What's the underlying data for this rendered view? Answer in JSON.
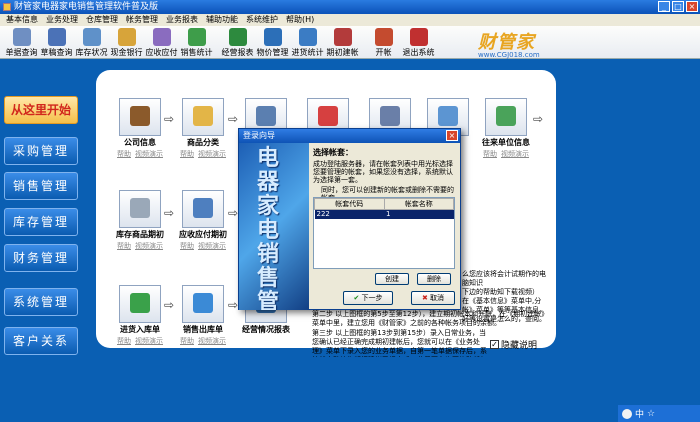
{
  "window": {
    "title": "财管家电器家电销售管理软件普及版",
    "min": "_",
    "max": "□",
    "close": "×"
  },
  "menu": [
    "基本信息",
    "业务处理",
    "仓库管理",
    "帐务管理",
    "业务报表",
    "辅助功能",
    "系统维护",
    "帮助(H)"
  ],
  "toolbar": [
    {
      "label": "单据查询",
      "icon": "document-search-icon",
      "color": "#6f8fc2"
    },
    {
      "label": "草稿查询",
      "icon": "draft-icon",
      "color": "#4b72b7"
    },
    {
      "label": "库存状况",
      "icon": "inventory-icon",
      "color": "#5f91c9"
    },
    {
      "label": "现金银行",
      "icon": "cash-icon",
      "color": "#d7a43a"
    },
    {
      "label": "应收应付",
      "icon": "receivable-icon",
      "color": "#8a6cbf"
    },
    {
      "label": "销售统计",
      "icon": "sales-stat-icon",
      "color": "#3e9d4a"
    },
    {
      "label": "经营报表",
      "icon": "report-icon",
      "color": "#2d8a3e"
    },
    {
      "label": "物价管理",
      "icon": "price-icon",
      "color": "#2c6fb8"
    },
    {
      "label": "进货统计",
      "icon": "purchase-stat-icon",
      "color": "#3b7cc4"
    },
    {
      "label": "期初建帐",
      "icon": "opening-account-icon",
      "color": "#b33b3b"
    },
    {
      "label": "开帐",
      "icon": "open-books-icon",
      "color": "#c44b2f"
    },
    {
      "label": "退出系统",
      "icon": "exit-icon",
      "color": "#c03030"
    }
  ],
  "brand": {
    "name": "财管家",
    "url": "www.CGJ018.com"
  },
  "nav": [
    "从这里开始",
    "采购管理",
    "销售管理",
    "库存管理",
    "财务管理",
    "系统管理",
    "客户关系"
  ],
  "modules": {
    "company": "公司信息",
    "product": "商品分类",
    "partner": "往来单位信息",
    "opening_stock": "库存商品期初",
    "opening_ar": "应收应付期初",
    "purchase_in": "进货入库单",
    "sales_out": "销售出库单",
    "business": "经营情况报表",
    "help": "帮助",
    "video": "视频演示"
  },
  "help_text": {
    "line1": "么您应该将会计试期作的电脑知识",
    "line2": "下边的帮助知下载视频）",
    "line3": "在《基本信息》菜单中,分",
    "line4": "帐》菜单》等等基本信息，",
    "line5": "好等设置是怎么的，查阅。",
    "step2": "第二步 以上图框的第5步至第12步），建立期初帐本和开账，在《期初建帐》菜单中里，建立您用《财管家》之前的各种帐务项目的余额。",
    "step3": "第三步 以上图框的第13步到第15步）录入日常业务，当您确认已经正确完成期初建帐后，您就可以在《业务处理》菜单下录入您的业务单据，自第一笔单据保存后，系统就自动认为期初建帐已经完成，此后不允许再修改任何期初。"
  },
  "hide_help": {
    "label": "隐藏说明",
    "checked": "✓"
  },
  "dialog": {
    "title": "登录向导",
    "close": "×",
    "banner": "电器家电销售管理软件",
    "heading": "选择帐套：",
    "desc": "成功登陆服务器，请在帐套列表中用光标选择您要管理的帐套，如果您没有选择，系统默认为选择第一套。",
    "note": "同时，您可以创建新的帐套或删除不需要的帐套。",
    "col_code": "帐套代码",
    "col_name": "帐套名称",
    "rows": [
      {
        "code": "222",
        "name": "1"
      }
    ],
    "create": "创建",
    "delete": "删除",
    "next": "下一步",
    "cancel": "取消",
    "next_mark": "✔",
    "cancel_mark": "✖"
  },
  "tray": {
    "lang": "中",
    "extra": "☆"
  }
}
